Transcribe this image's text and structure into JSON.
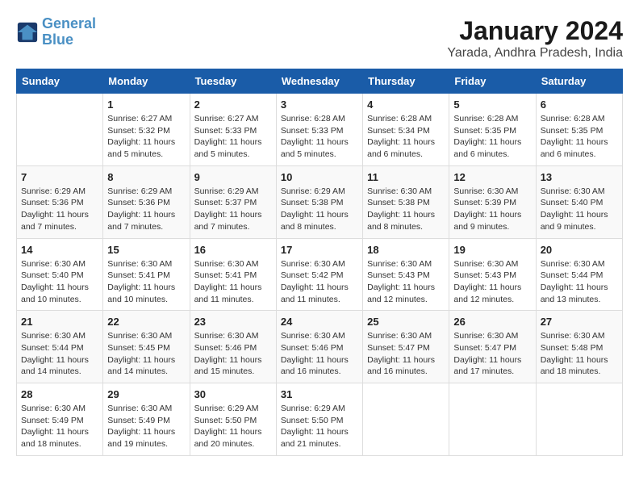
{
  "header": {
    "logo_line1": "General",
    "logo_line2": "Blue",
    "title": "January 2024",
    "subtitle": "Yarada, Andhra Pradesh, India"
  },
  "weekdays": [
    "Sunday",
    "Monday",
    "Tuesday",
    "Wednesday",
    "Thursday",
    "Friday",
    "Saturday"
  ],
  "weeks": [
    [
      {
        "day": "",
        "info": ""
      },
      {
        "day": "1",
        "info": "Sunrise: 6:27 AM\nSunset: 5:32 PM\nDaylight: 11 hours\nand 5 minutes."
      },
      {
        "day": "2",
        "info": "Sunrise: 6:27 AM\nSunset: 5:33 PM\nDaylight: 11 hours\nand 5 minutes."
      },
      {
        "day": "3",
        "info": "Sunrise: 6:28 AM\nSunset: 5:33 PM\nDaylight: 11 hours\nand 5 minutes."
      },
      {
        "day": "4",
        "info": "Sunrise: 6:28 AM\nSunset: 5:34 PM\nDaylight: 11 hours\nand 6 minutes."
      },
      {
        "day": "5",
        "info": "Sunrise: 6:28 AM\nSunset: 5:35 PM\nDaylight: 11 hours\nand 6 minutes."
      },
      {
        "day": "6",
        "info": "Sunrise: 6:28 AM\nSunset: 5:35 PM\nDaylight: 11 hours\nand 6 minutes."
      }
    ],
    [
      {
        "day": "7",
        "info": "Sunrise: 6:29 AM\nSunset: 5:36 PM\nDaylight: 11 hours\nand 7 minutes."
      },
      {
        "day": "8",
        "info": "Sunrise: 6:29 AM\nSunset: 5:36 PM\nDaylight: 11 hours\nand 7 minutes."
      },
      {
        "day": "9",
        "info": "Sunrise: 6:29 AM\nSunset: 5:37 PM\nDaylight: 11 hours\nand 7 minutes."
      },
      {
        "day": "10",
        "info": "Sunrise: 6:29 AM\nSunset: 5:38 PM\nDaylight: 11 hours\nand 8 minutes."
      },
      {
        "day": "11",
        "info": "Sunrise: 6:30 AM\nSunset: 5:38 PM\nDaylight: 11 hours\nand 8 minutes."
      },
      {
        "day": "12",
        "info": "Sunrise: 6:30 AM\nSunset: 5:39 PM\nDaylight: 11 hours\nand 9 minutes."
      },
      {
        "day": "13",
        "info": "Sunrise: 6:30 AM\nSunset: 5:40 PM\nDaylight: 11 hours\nand 9 minutes."
      }
    ],
    [
      {
        "day": "14",
        "info": "Sunrise: 6:30 AM\nSunset: 5:40 PM\nDaylight: 11 hours\nand 10 minutes."
      },
      {
        "day": "15",
        "info": "Sunrise: 6:30 AM\nSunset: 5:41 PM\nDaylight: 11 hours\nand 10 minutes."
      },
      {
        "day": "16",
        "info": "Sunrise: 6:30 AM\nSunset: 5:41 PM\nDaylight: 11 hours\nand 11 minutes."
      },
      {
        "day": "17",
        "info": "Sunrise: 6:30 AM\nSunset: 5:42 PM\nDaylight: 11 hours\nand 11 minutes."
      },
      {
        "day": "18",
        "info": "Sunrise: 6:30 AM\nSunset: 5:43 PM\nDaylight: 11 hours\nand 12 minutes."
      },
      {
        "day": "19",
        "info": "Sunrise: 6:30 AM\nSunset: 5:43 PM\nDaylight: 11 hours\nand 12 minutes."
      },
      {
        "day": "20",
        "info": "Sunrise: 6:30 AM\nSunset: 5:44 PM\nDaylight: 11 hours\nand 13 minutes."
      }
    ],
    [
      {
        "day": "21",
        "info": "Sunrise: 6:30 AM\nSunset: 5:44 PM\nDaylight: 11 hours\nand 14 minutes."
      },
      {
        "day": "22",
        "info": "Sunrise: 6:30 AM\nSunset: 5:45 PM\nDaylight: 11 hours\nand 14 minutes."
      },
      {
        "day": "23",
        "info": "Sunrise: 6:30 AM\nSunset: 5:46 PM\nDaylight: 11 hours\nand 15 minutes."
      },
      {
        "day": "24",
        "info": "Sunrise: 6:30 AM\nSunset: 5:46 PM\nDaylight: 11 hours\nand 16 minutes."
      },
      {
        "day": "25",
        "info": "Sunrise: 6:30 AM\nSunset: 5:47 PM\nDaylight: 11 hours\nand 16 minutes."
      },
      {
        "day": "26",
        "info": "Sunrise: 6:30 AM\nSunset: 5:47 PM\nDaylight: 11 hours\nand 17 minutes."
      },
      {
        "day": "27",
        "info": "Sunrise: 6:30 AM\nSunset: 5:48 PM\nDaylight: 11 hours\nand 18 minutes."
      }
    ],
    [
      {
        "day": "28",
        "info": "Sunrise: 6:30 AM\nSunset: 5:49 PM\nDaylight: 11 hours\nand 18 minutes."
      },
      {
        "day": "29",
        "info": "Sunrise: 6:30 AM\nSunset: 5:49 PM\nDaylight: 11 hours\nand 19 minutes."
      },
      {
        "day": "30",
        "info": "Sunrise: 6:29 AM\nSunset: 5:50 PM\nDaylight: 11 hours\nand 20 minutes."
      },
      {
        "day": "31",
        "info": "Sunrise: 6:29 AM\nSunset: 5:50 PM\nDaylight: 11 hours\nand 21 minutes."
      },
      {
        "day": "",
        "info": ""
      },
      {
        "day": "",
        "info": ""
      },
      {
        "day": "",
        "info": ""
      }
    ]
  ]
}
